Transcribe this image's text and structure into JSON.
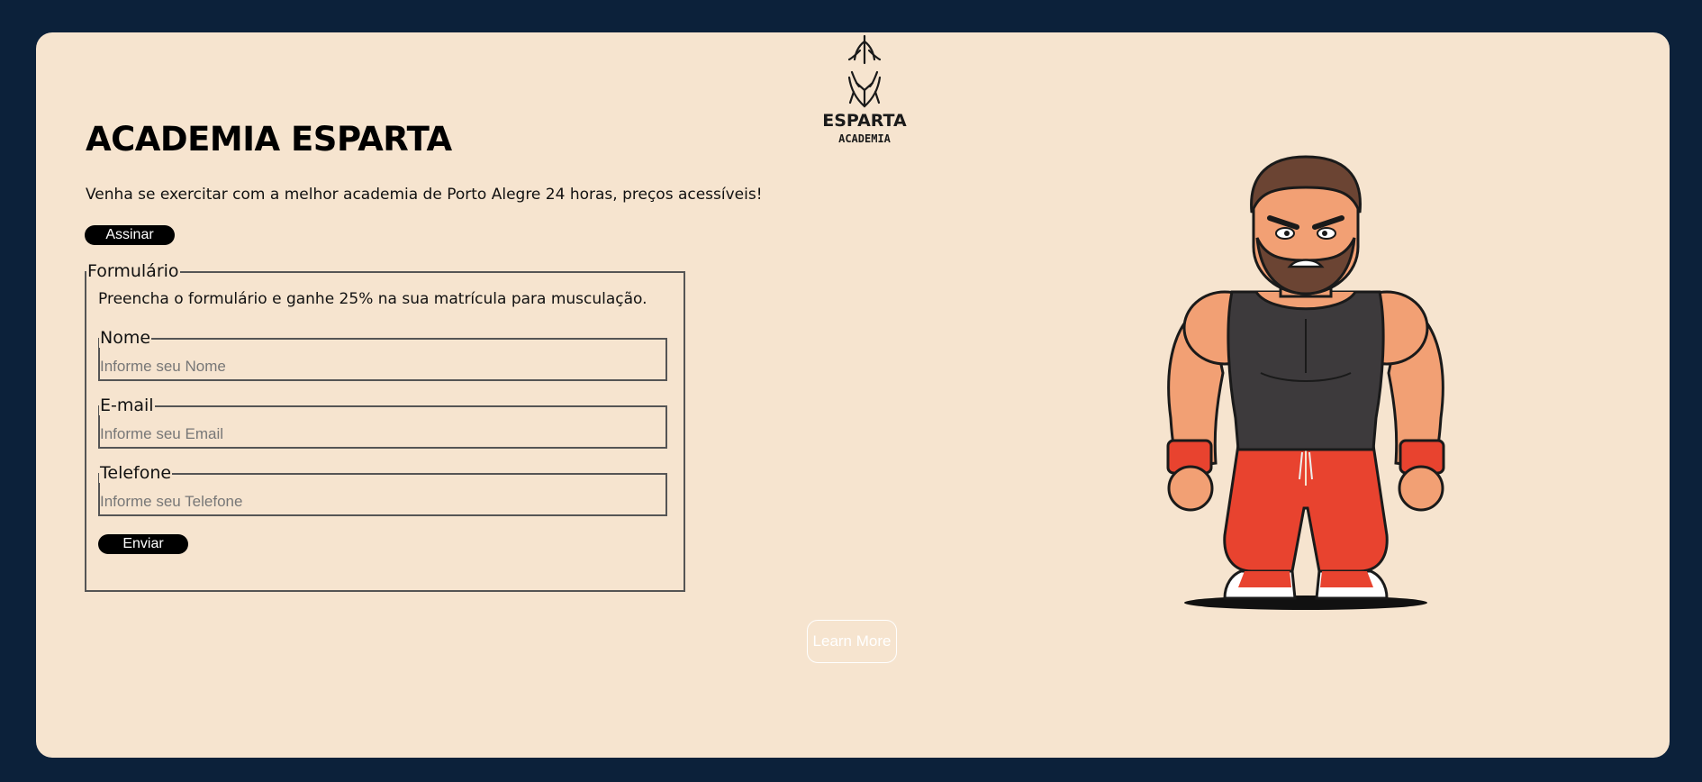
{
  "brand": {
    "logo_text": "ESPARTA",
    "logo_subtext": "ACADEMIA"
  },
  "hero": {
    "title": "ACADEMIA ESPARTA",
    "tagline": "Venha se exercitar com a melhor academia de Porto Alegre 24 horas, preços acessíveis!",
    "subscribe_label": "Assinar"
  },
  "form": {
    "legend": "Formulário",
    "intro": "Preencha o formulário e ganhe 25% na sua matrícula para musculação.",
    "fields": [
      {
        "label": "Nome",
        "placeholder": "Informe seu Nome",
        "value": ""
      },
      {
        "label": "E-mail",
        "placeholder": "Informe seu Email",
        "value": ""
      },
      {
        "label": "Telefone",
        "placeholder": "Informe seu Telefone",
        "value": ""
      }
    ],
    "submit_label": "Enviar"
  },
  "cta": {
    "learn_more_label": "Learn More"
  },
  "colors": {
    "page_background": "#0c213a",
    "card_background": "#f6e4cf",
    "button_background": "#000000",
    "button_text": "#ffffff",
    "mascot_pants": "#e8432f",
    "mascot_tank_top": "#3d3a3c"
  },
  "icons": {
    "logo": "spartan-helmet-logo",
    "mascot": "muscular-cartoon-gym-mascot"
  }
}
